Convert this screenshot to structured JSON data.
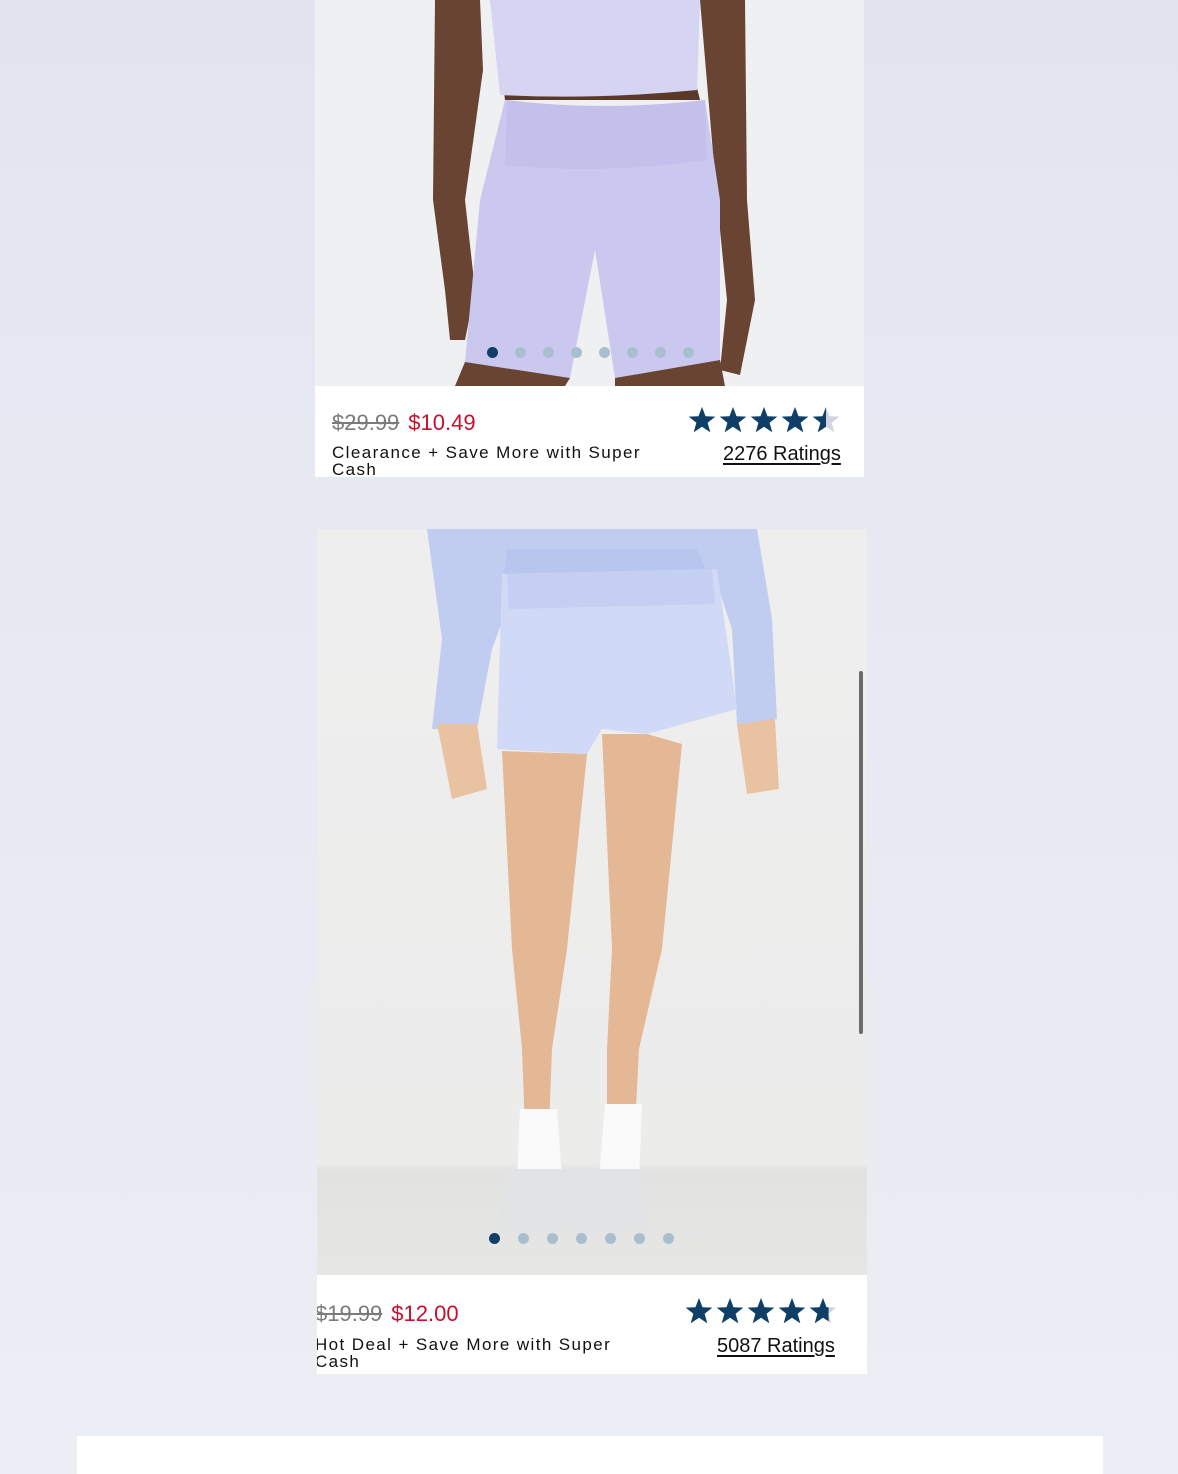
{
  "products": [
    {
      "price_original": "$29.99",
      "price_sale": "$10.49",
      "promo": "Clearance + Save More with Super Cash",
      "rating_stars": 4.5,
      "ratings_label": "2276 Ratings",
      "image_count": 8,
      "active_image": 1
    },
    {
      "price_original": "$19.99",
      "price_sale": "$12.00",
      "promo": "Hot Deal + Save More with Super Cash",
      "rating_stars": 4.7,
      "ratings_label": "5087 Ratings",
      "image_count": 7,
      "active_image": 1
    }
  ],
  "colors": {
    "sale_price": "#c8102e",
    "star": "#0f3f66",
    "dot_active": "#0f3f66",
    "dot_inactive": "#a9bfcf"
  },
  "icons": {
    "rating": "star-icon",
    "carousel": "carousel-dot"
  }
}
